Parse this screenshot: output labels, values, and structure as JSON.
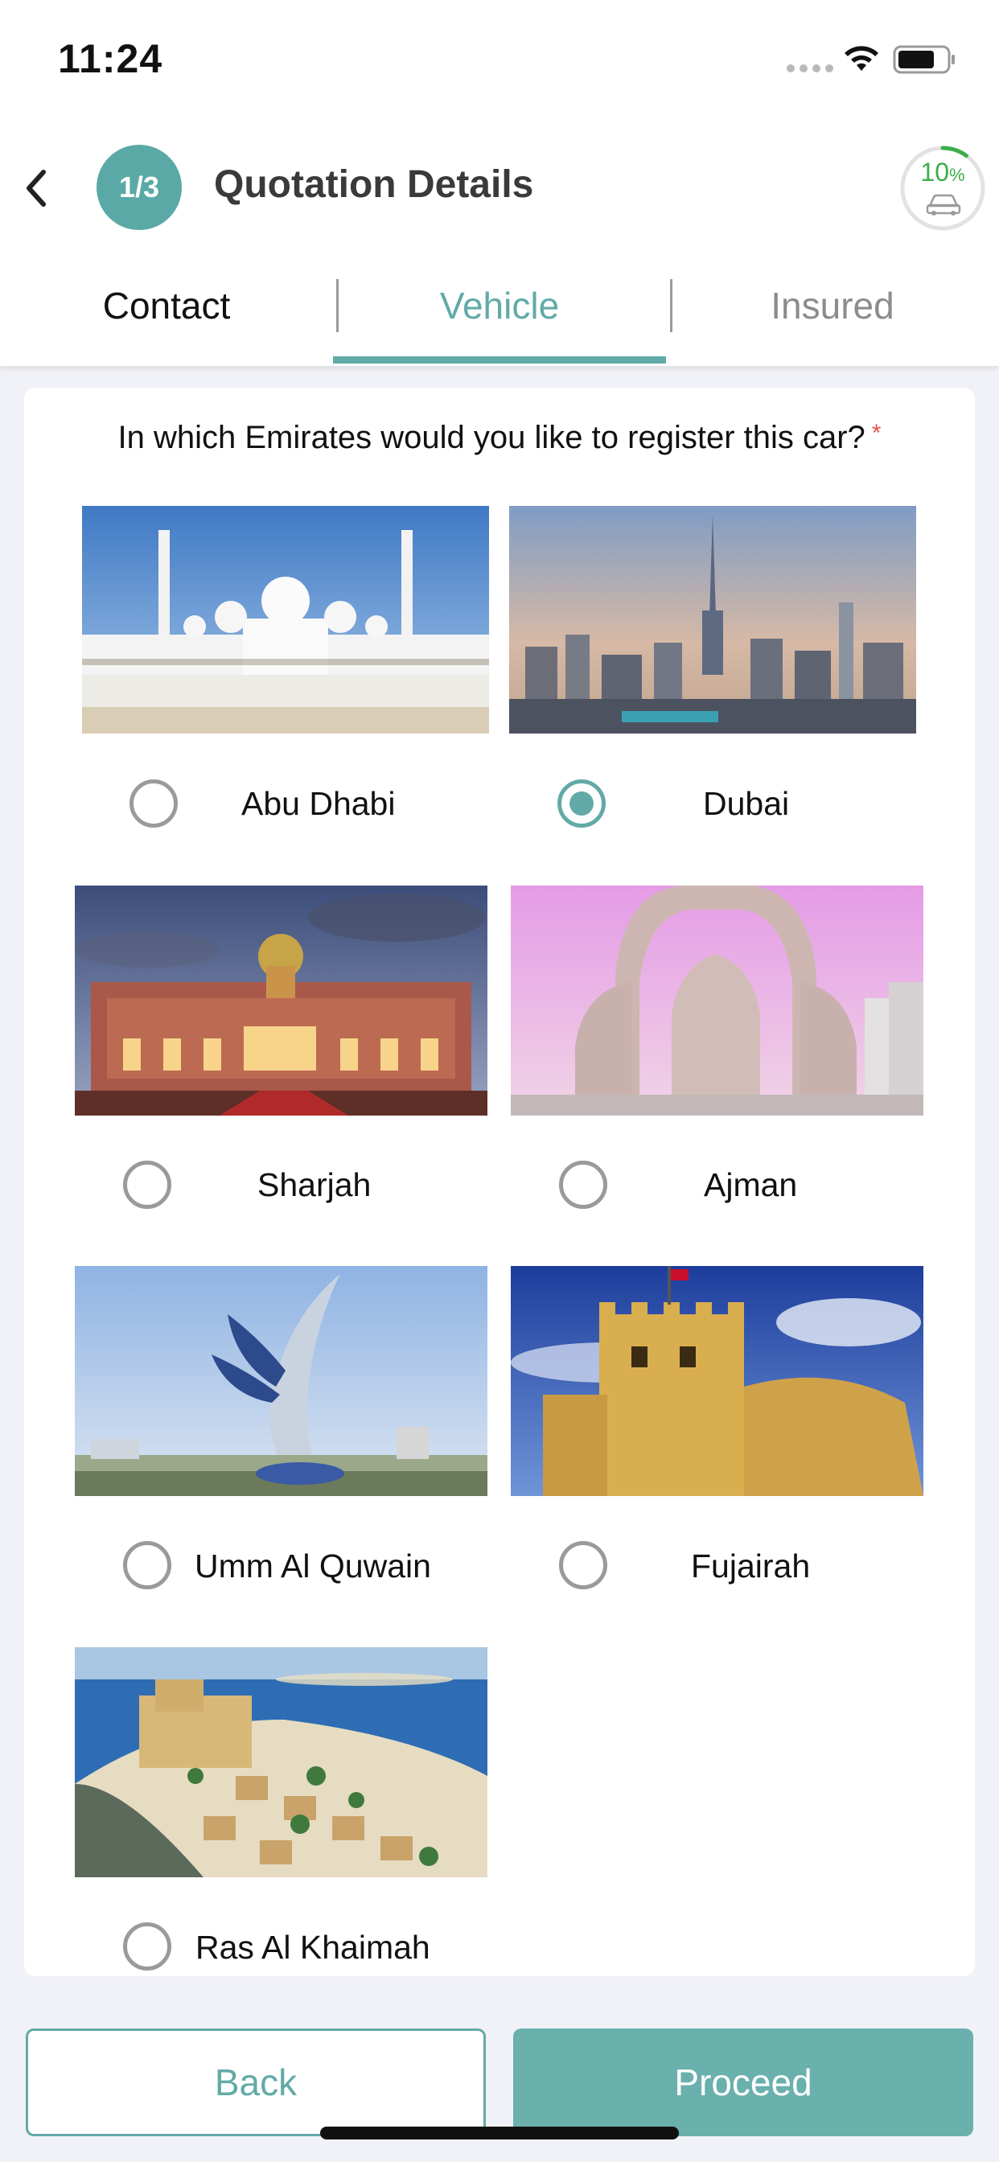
{
  "status_bar": {
    "time": "11:24"
  },
  "header": {
    "step_badge": "1/3",
    "title": "Quotation Details",
    "progress_value": "10",
    "progress_unit": "%",
    "progress_fraction": 0.1
  },
  "tabs": [
    {
      "label": "Contact",
      "state": "completed"
    },
    {
      "label": "Vehicle",
      "state": "active"
    },
    {
      "label": "Insured",
      "state": "inactive"
    }
  ],
  "question": {
    "text": "In which Emirates would you like to register this car?",
    "required_mark": "*"
  },
  "emirates": [
    {
      "label": "Abu Dhabi",
      "selected": false
    },
    {
      "label": "Dubai",
      "selected": true
    },
    {
      "label": "Sharjah",
      "selected": false
    },
    {
      "label": "Ajman",
      "selected": false
    },
    {
      "label": "Umm Al Quwain",
      "selected": false
    },
    {
      "label": "Fujairah",
      "selected": false
    },
    {
      "label": "Ras Al Khaimah",
      "selected": false
    }
  ],
  "buttons": {
    "back": "Back",
    "proceed": "Proceed"
  },
  "colors": {
    "accent": "#62aaa7",
    "progress": "#3cae4a",
    "required": "#e55050"
  }
}
